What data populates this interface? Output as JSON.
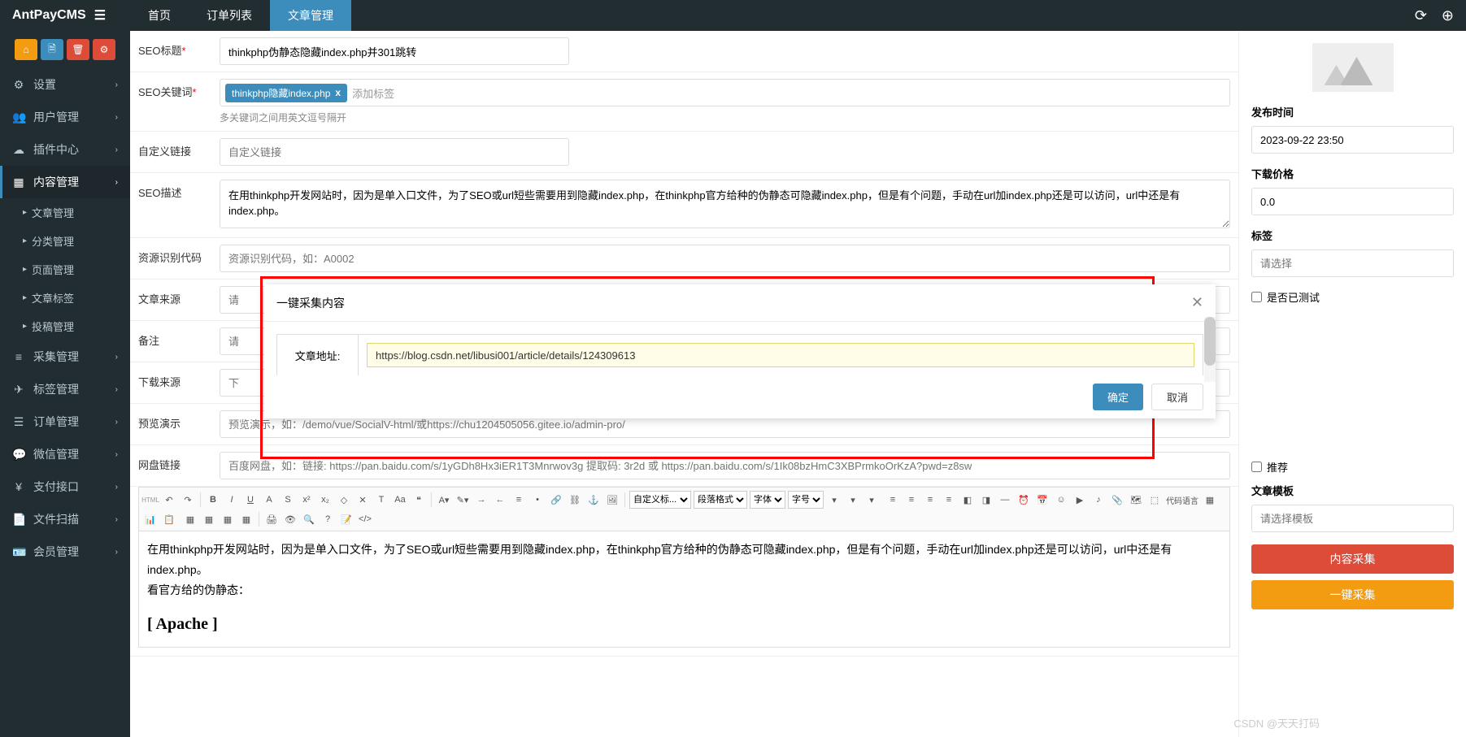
{
  "brand": "AntPayCMS",
  "topnav": [
    "首页",
    "订单列表",
    "文章管理"
  ],
  "topnav_active": 2,
  "sidebar": {
    "items": [
      {
        "icon": "⚙",
        "label": "设置"
      },
      {
        "icon": "👥",
        "label": "用户管理"
      },
      {
        "icon": "☁",
        "label": "插件中心"
      },
      {
        "icon": "▦",
        "label": "内容管理",
        "active": true,
        "subs": [
          "文章管理",
          "分类管理",
          "页面管理",
          "文章标签",
          "投稿管理"
        ]
      },
      {
        "icon": "≡",
        "label": "采集管理"
      },
      {
        "icon": "✈",
        "label": "标签管理"
      },
      {
        "icon": "☰",
        "label": "订单管理"
      },
      {
        "icon": "💬",
        "label": "微信管理"
      },
      {
        "icon": "¥",
        "label": "支付接口"
      },
      {
        "icon": "📄",
        "label": "文件扫描"
      },
      {
        "icon": "🪪",
        "label": "会员管理"
      }
    ]
  },
  "form": {
    "seo_title": {
      "label": "SEO标题",
      "value": "thinkphp伪静态隐藏index.php并301跳转"
    },
    "seo_keywords": {
      "label": "SEO关键词",
      "tag": "thinkphp隐藏index.php",
      "placeholder": "添加标签",
      "hint": "多关键词之间用英文逗号隔开"
    },
    "custom_link": {
      "label": "自定义链接",
      "placeholder": "自定义链接"
    },
    "seo_desc": {
      "label": "SEO描述",
      "value": "在用thinkphp开发网站时，因为是单入口文件，为了SEO或url短些需要用到隐藏index.php，在thinkphp官方给种的伪静态可隐藏index.php，但是有个问题，手动在url加index.php还是可以访问，url中还是有index.php。"
    },
    "resource_code": {
      "label": "资源识别代码",
      "placeholder": "资源识别代码，如：A0002"
    },
    "source": {
      "label": "文章来源",
      "placeholder": "请"
    },
    "remark": {
      "label": "备注",
      "placeholder": "请"
    },
    "download": {
      "label": "下载来源",
      "placeholder": "下"
    },
    "preview": {
      "label": "预览演示",
      "placeholder": "预览演示，如：/demo/vue/SocialV-html/或https://chu1204505056.gitee.io/admin-pro/"
    },
    "netdisk": {
      "label": "网盘链接",
      "placeholder": "百度网盘，如：链接: https://pan.baidu.com/s/1yGDh8Hx3iER1T3Mnrwov3g 提取码: 3r2d 或 https://pan.baidu.com/s/1Ik08bzHmC3XBPrmkoOrKzA?pwd=z8sw"
    }
  },
  "editor_selects": [
    "自定义标...",
    "段落格式",
    "字体",
    "字号"
  ],
  "editor_content": {
    "p1": "在用thinkphp开发网站时，因为是单入口文件，为了SEO或url短些需要用到隐藏index.php，在thinkphp官方给种的伪静态可隐藏index.php，但是有个问题，手动在url加index.php还是可以访问，url中还是有index.php。",
    "p2": "看官方给的伪静态：",
    "h3": "[ Apache ]"
  },
  "right": {
    "publish_label": "发布时间",
    "publish_value": "2023-09-22 23:50",
    "price_label": "下载价格",
    "price_value": "0.0",
    "tags_label": "标签",
    "tags_placeholder": "请选择",
    "check_tested": "是否已测试",
    "check_recommend": "推荐",
    "template_label": "文章模板",
    "template_placeholder": "请选择模板",
    "btn_collect": "内容采集",
    "btn_onekey": "一键采集"
  },
  "modal": {
    "title": "一键采集内容",
    "url_label": "文章地址:",
    "url_value": "https://blog.csdn.net/libusi001/article/details/124309613",
    "confirm": "确定",
    "cancel": "取消"
  },
  "watermark": "CSDN @天天打码"
}
